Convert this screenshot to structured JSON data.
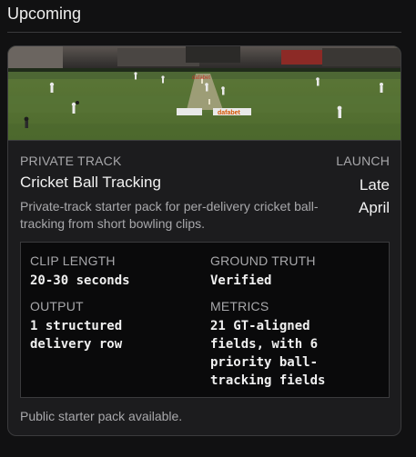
{
  "section": {
    "title": "Upcoming"
  },
  "card": {
    "image": {
      "description": "Cricket match broadcast frame",
      "ad_text_1": "dafabet",
      "ad_text_2": "dafabet"
    },
    "eyebrow": "PRIVATE TRACK",
    "title": "Cricket Ball Tracking",
    "launch_label": "LAUNCH",
    "launch_value": "Late April",
    "description": "Private-track starter pack for per-delivery cricket ball-tracking from short bowling clips.",
    "specs": [
      {
        "label": "CLIP LENGTH",
        "value": "20-30 seconds"
      },
      {
        "label": "GROUND TRUTH",
        "value": "Verified"
      },
      {
        "label": "OUTPUT",
        "value": "1 structured\ndelivery row"
      },
      {
        "label": "METRICS",
        "value": "21 GT-aligned\nfields, with 6\npriority ball-\ntracking fields"
      }
    ],
    "footer_note": "Public starter pack available."
  }
}
